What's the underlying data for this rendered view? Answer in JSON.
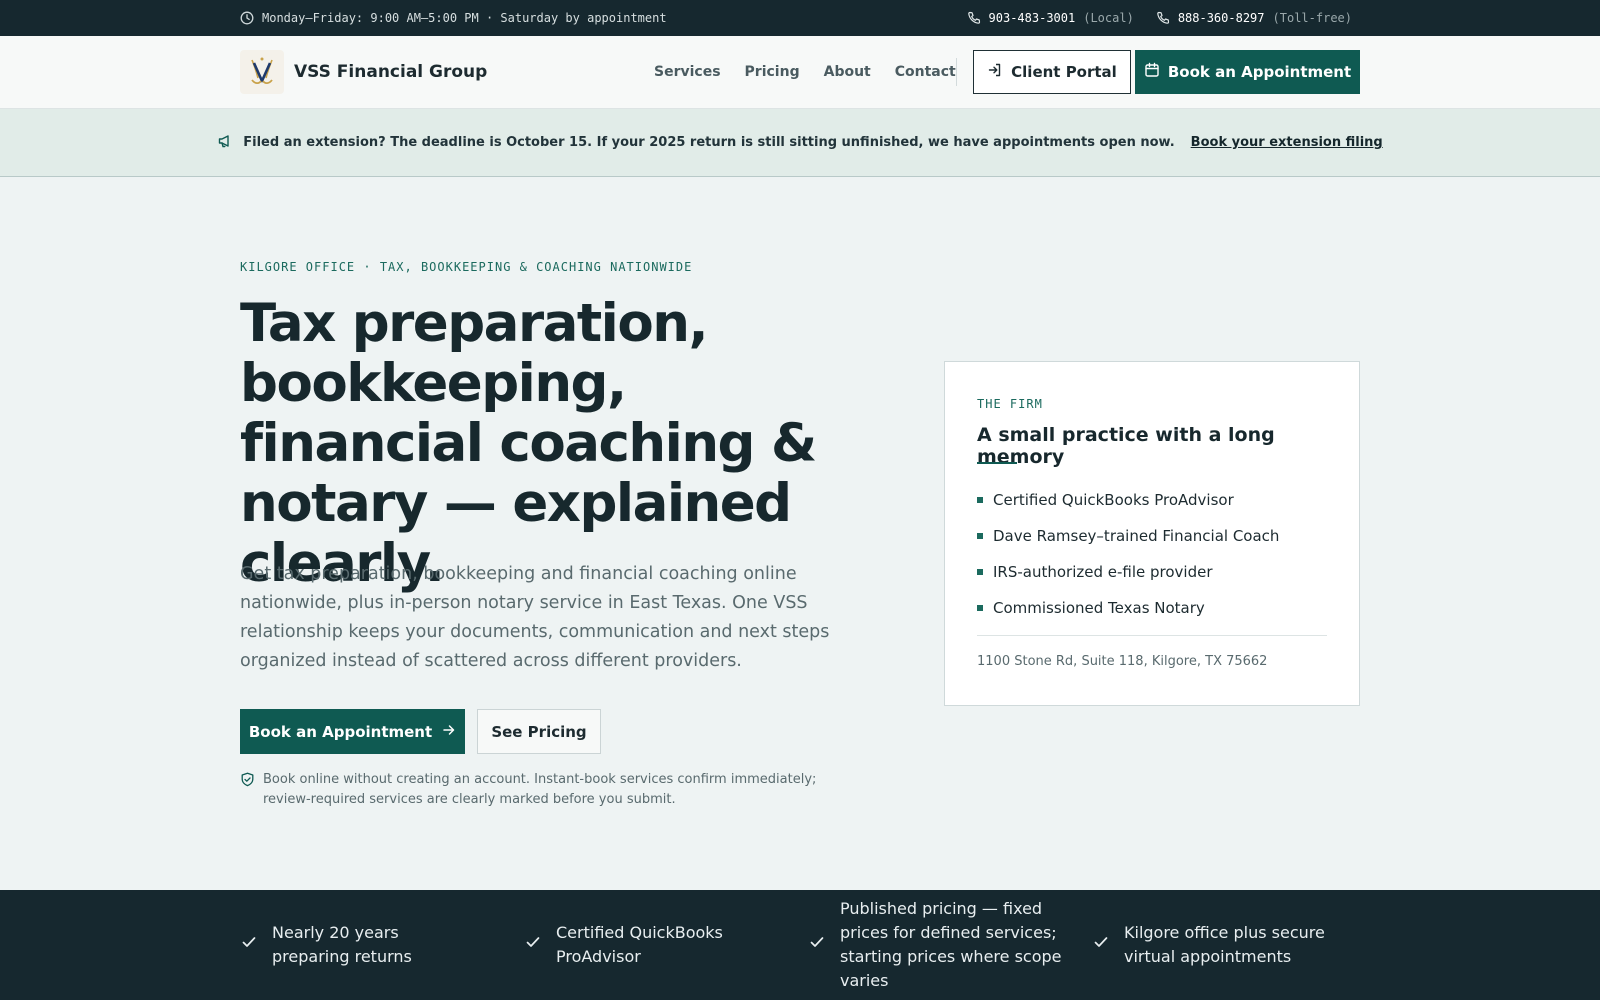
{
  "topbar": {
    "hours": "Monday–Friday: 9:00 AM–5:00 PM · Saturday by appointment",
    "phones": [
      {
        "number": "903-483-3001",
        "label": "(Local)"
      },
      {
        "number": "888-360-8297",
        "label": "(Toll-free)"
      }
    ]
  },
  "header": {
    "brand": "VSS Financial Group",
    "nav": [
      "Services",
      "Pricing",
      "About",
      "Contact"
    ],
    "portal_label": "Client Portal",
    "book_label": "Book an Appointment"
  },
  "announcement": {
    "message": "Filed an extension? The deadline is October 15. If your 2025 return is still sitting unfinished, we have appointments open now.",
    "link": "Book your extension filing"
  },
  "hero": {
    "eyebrow": "KILGORE OFFICE · TAX, BOOKKEEPING & COACHING NATIONWIDE",
    "title": "Tax preparation, bookkeeping, financial coaching & notary — explained clearly.",
    "subtitle": "Get tax preparation, bookkeeping and financial coaching online nationwide, plus in-person notary service in East Texas. One VSS relationship keeps your documents, communication and next steps organized instead of scattered across different providers.",
    "book_label": "Book an Appointment",
    "pricing_label": "See Pricing",
    "note": "Book online without creating an account. Instant-book services confirm immediately; review-required services are clearly marked before you submit."
  },
  "firm_card": {
    "eyebrow": "THE FIRM",
    "title": "A small practice with a long memory",
    "items": [
      "Certified QuickBooks ProAdvisor",
      "Dave Ramsey–trained Financial Coach",
      "IRS-authorized e-file provider",
      "Commissioned Texas Notary"
    ],
    "address": "1100 Stone Rd, Suite 118, Kilgore, TX 75662"
  },
  "features": [
    "Nearly 20 years preparing returns",
    "Certified QuickBooks ProAdvisor",
    "Published pricing — fixed prices for defined services; starting prices where scope varies",
    "Kilgore office plus secure virtual appointments"
  ],
  "colors": {
    "accent": "#0f5a52",
    "dark": "#16282f",
    "background": "#eef3f3"
  }
}
